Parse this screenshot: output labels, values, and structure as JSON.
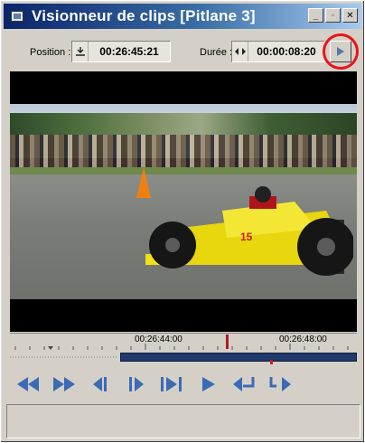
{
  "window": {
    "title": "Visionneur de clips [Pitlane 3]",
    "icon": "clip-viewer-icon",
    "buttons": [
      "minimize-icon",
      "maximize-icon",
      "close-icon"
    ]
  },
  "toolbar": {
    "position_label": "Position :",
    "position_value": "00:26:45:21",
    "duration_label": "Durée :",
    "duration_value": "00:00:08:20"
  },
  "timeline": {
    "labels": [
      "00:26:44:00",
      "00:26:48:00"
    ]
  },
  "colors": {
    "title_start": "#0a246a",
    "title_end": "#a6caf0",
    "highlight_circle": "#e8141b",
    "transport_icon": "#3c6bb5",
    "scrub_track": "#1f3a6a"
  },
  "transport": [
    "rewind-icon",
    "fast-forward-icon",
    "step-back-icon",
    "step-forward-icon",
    "go-to-end-icon",
    "play-icon",
    "mark-in-icon",
    "mark-out-icon"
  ]
}
